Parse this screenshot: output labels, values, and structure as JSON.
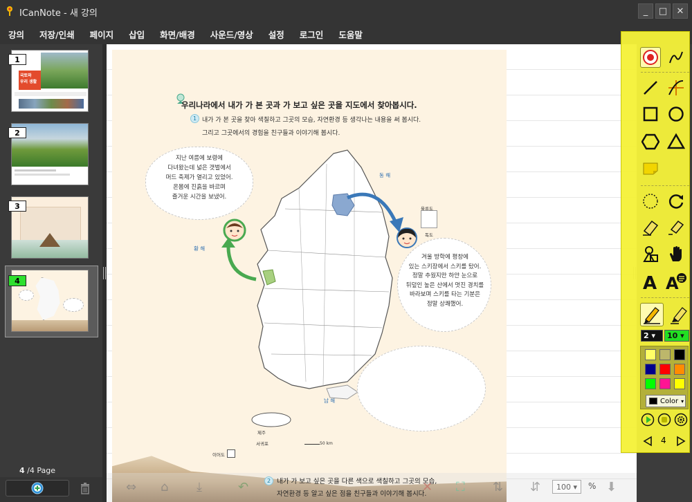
{
  "window": {
    "title": "ICanNote - 새 강의",
    "minimize": "_",
    "maximize": "□",
    "close": "✕"
  },
  "menu": [
    "강의",
    "저장/인쇄",
    "페이지",
    "삽입",
    "화면/배경",
    "사운드/영상",
    "설정",
    "로그인",
    "도움말"
  ],
  "thumbnails": [
    {
      "num": "1",
      "title_line1": "국토와",
      "title_line2": "우리 생활"
    },
    {
      "num": "2"
    },
    {
      "num": "3"
    },
    {
      "num": "4"
    }
  ],
  "page_indicator": {
    "current": "4",
    "total_label": "/4 Page"
  },
  "document": {
    "heading": "우리나라에서 내가 가 본 곳과 가 보고 싶은 곳을 지도에서 찾아봅시다.",
    "step": "1",
    "instruction_line1": "내가 가 본 곳을 찾아 색칠하고 그곳의 모습, 자연환경 등 생각나는 내용을 써 봅시다.",
    "instruction_line2": "그리고 그곳에서의 경험을 친구들과 이야기해 봅시다.",
    "bubble_left": [
      "지난 여름에 보령에",
      "다녀왔는데 넓은 갯벌에서",
      "머드 축제가 열리고 있었어.",
      "온몸에 진흙을 바르며",
      "즐거운 시간을 보냈어."
    ],
    "bubble_right": [
      "겨울 방학에 평창에",
      "있는 스키장에서 스키를 탔어.",
      "정말 추웠지만 하얀 눈으로",
      "뒤덮인 높은 산에서 멋진 경치를",
      "바라보며 스키를 타는 기분은",
      "정말 상쾌했어."
    ],
    "sea_west": "황 해",
    "sea_east": "동 해",
    "sea_south": "남 해",
    "ulleung": "울릉도",
    "dokdo": "독도",
    "jeju": "제주",
    "seogwipo": "서귀포",
    "ieodo": "이어도",
    "scale": "50 km",
    "bottom_step": "2",
    "bottom_line1": "내가 가 보고 싶은 곳을 다른 색으로 색칠하고 그곳의 모습,",
    "bottom_line2": "자연환경 등 알고 싶은 점을 친구들과 이야기해 봅시다."
  },
  "zoom": {
    "value": "100",
    "unit": "%"
  },
  "tools": {
    "pen_size": "2",
    "opacity": "10",
    "color_label": "Color",
    "page_num": "4",
    "palette": [
      "#ffff66",
      "#bdb76b",
      "#000000",
      "#00008b",
      "#ff0000",
      "#ff8c00",
      "#00ff00",
      "#ff1493",
      "#ffff00"
    ],
    "selected_color": "#000000",
    "accent": "#f5f23a"
  }
}
